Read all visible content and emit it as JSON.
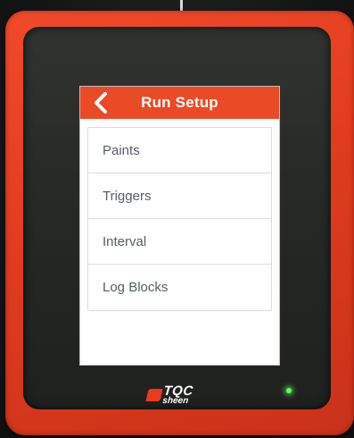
{
  "screen": {
    "title": "Run Setup",
    "back_icon": "chevron-left-icon",
    "menu": [
      {
        "label": "Paints"
      },
      {
        "label": "Triggers"
      },
      {
        "label": "Interval"
      },
      {
        "label": "Log Blocks"
      }
    ]
  },
  "brand": {
    "logo_line1": "TQC",
    "logo_line2": "sheen"
  },
  "colors": {
    "accent": "#ea4a26",
    "device_body": "#e03c1e",
    "led": "#5cff5a"
  },
  "status": {
    "led": "on"
  }
}
